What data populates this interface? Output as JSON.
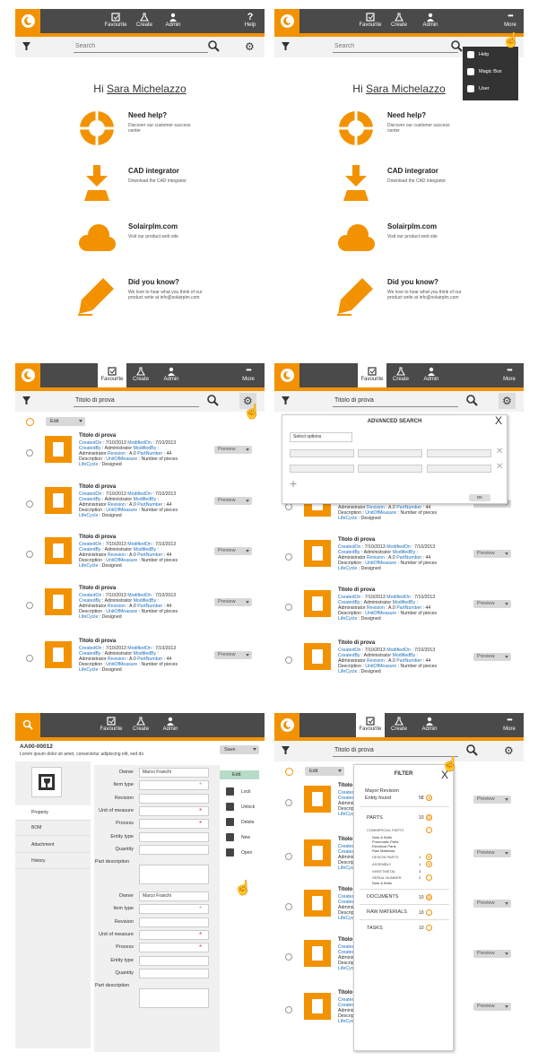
{
  "nav": {
    "favourite": "Favourite",
    "create": "Create",
    "admin": "Admin",
    "help": "Help",
    "more": "More"
  },
  "search": {
    "placeholder": "Search",
    "query": "Titolo di prova"
  },
  "home": {
    "greeting": "Hi",
    "user_name": "Sara Michelazzo",
    "help_title": "Need help?",
    "help_desc": "Discover our customer success center",
    "cad_title": "CAD integrator",
    "cad_desc": "Download the CAD integrator",
    "site_title": "Solairplm.com",
    "site_desc": "Visit our product web site",
    "know_title": "Did you know?",
    "know_desc": "We love to hear what you think of our product write at info@solairplm.com"
  },
  "more_menu": {
    "help": "Help",
    "magic_box": "Magic Box",
    "user": "User"
  },
  "list": {
    "edit_label": "Edit",
    "item": {
      "title": "Titolo di prova",
      "created_on_k": "CreatedOn",
      "created_on_v": "7/10/2013",
      "modified_on_k": "ModifiedOn",
      "modified_on_v": "7/10/2013",
      "created_by_k": "CreatedBy",
      "created_by_v": "Administrator",
      "modified_by_k": "ModifiedBy",
      "administrator": "Administrator",
      "revision_k": "Revision",
      "revision_v": "A.0",
      "part_number_k": "PartNumber",
      "part_number_v": "44",
      "description_k": "Description",
      "uom_k": "UnitOfMeasure",
      "uom_v": "Number of pieces",
      "lifecycle_k": "LifeCycle",
      "lifecycle_v": "Designed",
      "preview": "Preview"
    }
  },
  "adv_search": {
    "title": "ADVANCED SEARCH",
    "select_option": "Select options",
    "ok": "OK",
    "close": "X",
    "add": "+"
  },
  "detail": {
    "code": "AA00-00012",
    "subtitle": "Lorem ipsum dolor sit amet, consectetur adipiscing elit, sed do",
    "save": "Save",
    "tabs": [
      "Property",
      "BOM",
      "Attachment",
      "History"
    ],
    "fields": [
      "Owner",
      "Item type",
      "Revision",
      "Unit of measure",
      "Process",
      "Entity type",
      "Quantity",
      "Part description"
    ],
    "owner_value": "Marco Franchi",
    "edit": "Edit",
    "actions": [
      "Lock",
      "Unlock",
      "Delete",
      "New",
      "Open"
    ]
  },
  "filter": {
    "title": "FILTER",
    "close": "X",
    "mayor_revision": "Mayor Revision",
    "entity_found": "Entity found",
    "entity_count": "58",
    "parts": "PARTS",
    "parts_count": "10",
    "commercial_parts": "COMMERCIAL PARTS",
    "commercial_items": [
      "Nuts & Bolts",
      "Pneumatic Parts",
      "Electrical Parts",
      "Raw Materials"
    ],
    "design_parts": "DESIGN PARTS",
    "design_count": "1",
    "assembly": "ASSEMBLY",
    "assembly_count": "1",
    "sheetmetal": "SHEETMETAL",
    "sheetmetal_count": "3",
    "serial_number": "SERIAL NUMBER",
    "serial_count": "2",
    "serial_item": "Nuts & Bolts",
    "documents": "DOCUMENTS",
    "documents_count": "10",
    "raw_materials": "RAW MATERIALS",
    "raw_count": "10",
    "tasks": "TASKS",
    "tasks_count": "10"
  },
  "colors": {
    "accent": "#f39200",
    "bar": "#4a4a4a",
    "link": "#1f6fb8"
  }
}
